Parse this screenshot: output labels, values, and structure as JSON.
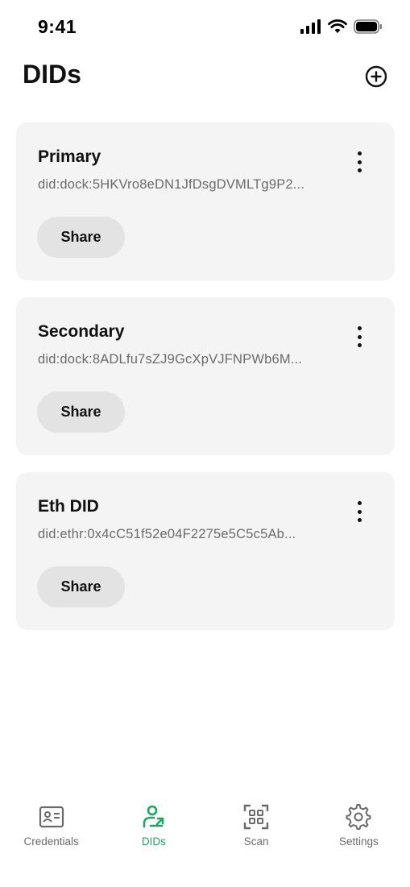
{
  "status_bar": {
    "time": "9:41"
  },
  "header": {
    "title": "DIDs",
    "add_icon": "plus-circle-icon"
  },
  "dids": [
    {
      "name": "Primary",
      "value": "did:dock:5HKVro8eDN1JfDsgDVMLTg9P2...",
      "share_label": "Share"
    },
    {
      "name": "Secondary",
      "value": "did:dock:8ADLfu7sZJ9GcXpVJFNPWb6M...",
      "share_label": "Share"
    },
    {
      "name": "Eth DID",
      "value": "did:ethr:0x4cC51f52e04F2275e5C5c5Ab...",
      "share_label": "Share"
    }
  ],
  "bottom_nav": {
    "items": [
      {
        "label": "Credentials",
        "icon": "id-card-icon",
        "active": false
      },
      {
        "label": "DIDs",
        "icon": "user-arrow-icon",
        "active": true
      },
      {
        "label": "Scan",
        "icon": "qr-scan-icon",
        "active": false
      },
      {
        "label": "Settings",
        "icon": "gear-icon",
        "active": false
      }
    ]
  },
  "colors": {
    "accent": "#1aa85f",
    "card_bg": "#f4f4f4",
    "button_bg": "#e3e3e3",
    "text_secondary": "#6b6b6b"
  }
}
